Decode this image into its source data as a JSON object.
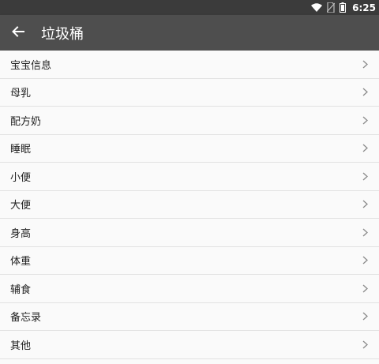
{
  "status_bar": {
    "time": "6:25",
    "icons": [
      "wifi-icon",
      "no-sim-icon",
      "battery-icon"
    ]
  },
  "app_bar": {
    "title": "垃圾桶",
    "back_icon": "arrow-left-icon"
  },
  "list": {
    "items": [
      {
        "label": "宝宝信息"
      },
      {
        "label": "母乳"
      },
      {
        "label": "配方奶"
      },
      {
        "label": "睡眠"
      },
      {
        "label": "小便"
      },
      {
        "label": "大便"
      },
      {
        "label": "身高"
      },
      {
        "label": "体重"
      },
      {
        "label": "辅食"
      },
      {
        "label": "备忘录"
      },
      {
        "label": "其他"
      }
    ],
    "chevron_icon": "chevron-right-icon"
  },
  "colors": {
    "status_bar": "#3b3b3b",
    "app_bar": "#4e4e4e",
    "background": "#fafafa",
    "divider": "#e2e2e2",
    "text": "#222222",
    "chevron": "#8a8a8a"
  }
}
